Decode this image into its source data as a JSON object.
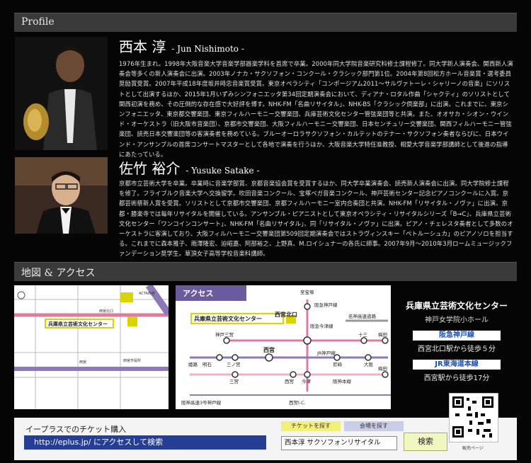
{
  "profile": {
    "header": "Profile",
    "people": [
      {
        "name_jp": "西本 淳",
        "name_en": "- Jun Nishimoto -",
        "bio": "1976年生まれ。1998年大阪音楽大学音楽学部器楽学科を首席で卒業。2000年同大学院音楽研究科修士課程修了。同大学新人演奏会、関西新人演奏会等多くの新人演奏会に出演。2003年ノナカ・サクソフォン・コンクール・クラシック部門第1位。2004年第8回松方ホール音楽賞・選考委員奨励賞受賞。2007年平成18年度坂井時忠音楽賞受賞。東京オペラシティ「コンポージアム2011〜サルヴァトーレ・シャリーノの音楽」にソリストとして出演するほか、2015年1月いずみシンフォニエッタ第34回定期演奏会において、ディアナ・ロタル作曲「シャクティ」のソリストとして関西初演を務め、その圧倒的な存在感で大好評を博す。NHK-FM「名曲リサイタル」、NHK-BS「クラシック倶楽部」に出演。これまでに、東京シンフォニエッタ、東京都交響楽団、東京フィルハーモニー交響楽団、兵庫芸術文化センター管弦楽団等と共演。また、オオサカ・シオン・ウインド・オーケストラ（旧大阪市音楽団）、京都市交響楽団、大阪フィルハーモニー交響楽団、日本センチュリー交響楽団、関西フィルハーモニー管弦楽団、読売日本交響楽団等の客演奏者を務めている。ブルーオーロラサクソフォン・カルテットのテナー・サクソフォン奏者ならびに、日本ウインド・アンサンブルの首席コンサートマスターとして各地で演奏を行うほか、大阪音楽大学特任准教授、相愛大学音楽学部講師として後進の指導にあたっている。"
      },
      {
        "name_jp": "佐竹 裕介",
        "name_en": "- Yusuke Satake -",
        "bio": "京都市立芸術大学を卒業。卒業時に音楽学部賞、京都音楽協会賞を受賞するほか、同大学卒業演奏会、読売新人演奏会に出演。同大学院修士課程を修了。フライブルク音楽大学へ交換留学。吹田音楽コンクール、宝塚ベガ音楽コンクール、神戸芸術センター記念ピアノコンクールに入賞。京都芸術祭新人賞を受賞。ソリストとして京都市交響楽団、京都フィルハーモニー室内合奏団と共演。NHK-FM「リサイタル・ノヴァ」に出演。京都・勝楽寺では毎年リサイタルを開催している。アンサンブル・ピアニストとして東京オペラシティ・リサイタルシリーズ「B→C」、兵庫県立芸術文化センター「ワンコインコンサート」、NHK-FM「名曲リサイタル」、同「リサイタル・ノヴァ」に出演。ピアノ・チェレスタ奏者として多数のオーケストラに客演しており、大阪フィルハーモニー交響楽団第509回定期演奏会ではストラヴィンスキー「ペトルーシュカ」のピアノソロを担当する。これまでに森本雅子、雨澤隆宏、迫昭嘉、阿部裕之、上野真、M.ロイシュナーの各氏に師事。2007年9月〜2010年3月ロームミュージックファンデーション奨学生。華頂女子高等学校音楽科講師。"
      }
    ]
  },
  "access": {
    "header": "地図 & アクセス",
    "map1": {
      "venue_label": "兵庫県立芸術文化センター",
      "labels": [
        "ACTA西宮",
        "西宮市役所",
        "西宮",
        "西宮北口"
      ]
    },
    "map2": {
      "title": "アクセス",
      "venue_label": "兵庫県立芸術文化センター",
      "stations": [
        "西宮北口",
        "至宝塚",
        "阪急今津線",
        "阪急神戸線",
        "名神高速道路",
        "神戸三宮",
        "西宮",
        "梅田",
        "十三",
        "JR神戸線",
        "尼崎",
        "大阪",
        "姫路",
        "明石",
        "三ノ宮",
        "三宮",
        "阪神本線",
        "西宮",
        "今津",
        "梅田",
        "阪神高速3号神戸線",
        "西宮I.C."
      ]
    },
    "venue": {
      "title": "兵庫県立芸術文化センター",
      "hall": "神戸女学院小ホール",
      "line1": "阪急神戸線",
      "walk1": "西宮北口駅から徒歩５分",
      "line2": "JR東海道本線",
      "walk2": "西宮駅から徒歩17分"
    }
  },
  "ticket": {
    "title": "イープラスでのチケット購入",
    "url_text": "http://eplus.jp/ にアクセスして検索",
    "tab_ticket": "チケットを探す",
    "tab_venue": "会場を探す",
    "search_value": "西本淳 サクソフォンリサイタル",
    "search_button": "検索",
    "qr_caption": "販売ページ"
  },
  "colors": {
    "accent_blue": "#253d92",
    "venue_yellow": "#d9d400",
    "line_pink": "#e07aa2",
    "line_purple": "#8c7ab8"
  }
}
